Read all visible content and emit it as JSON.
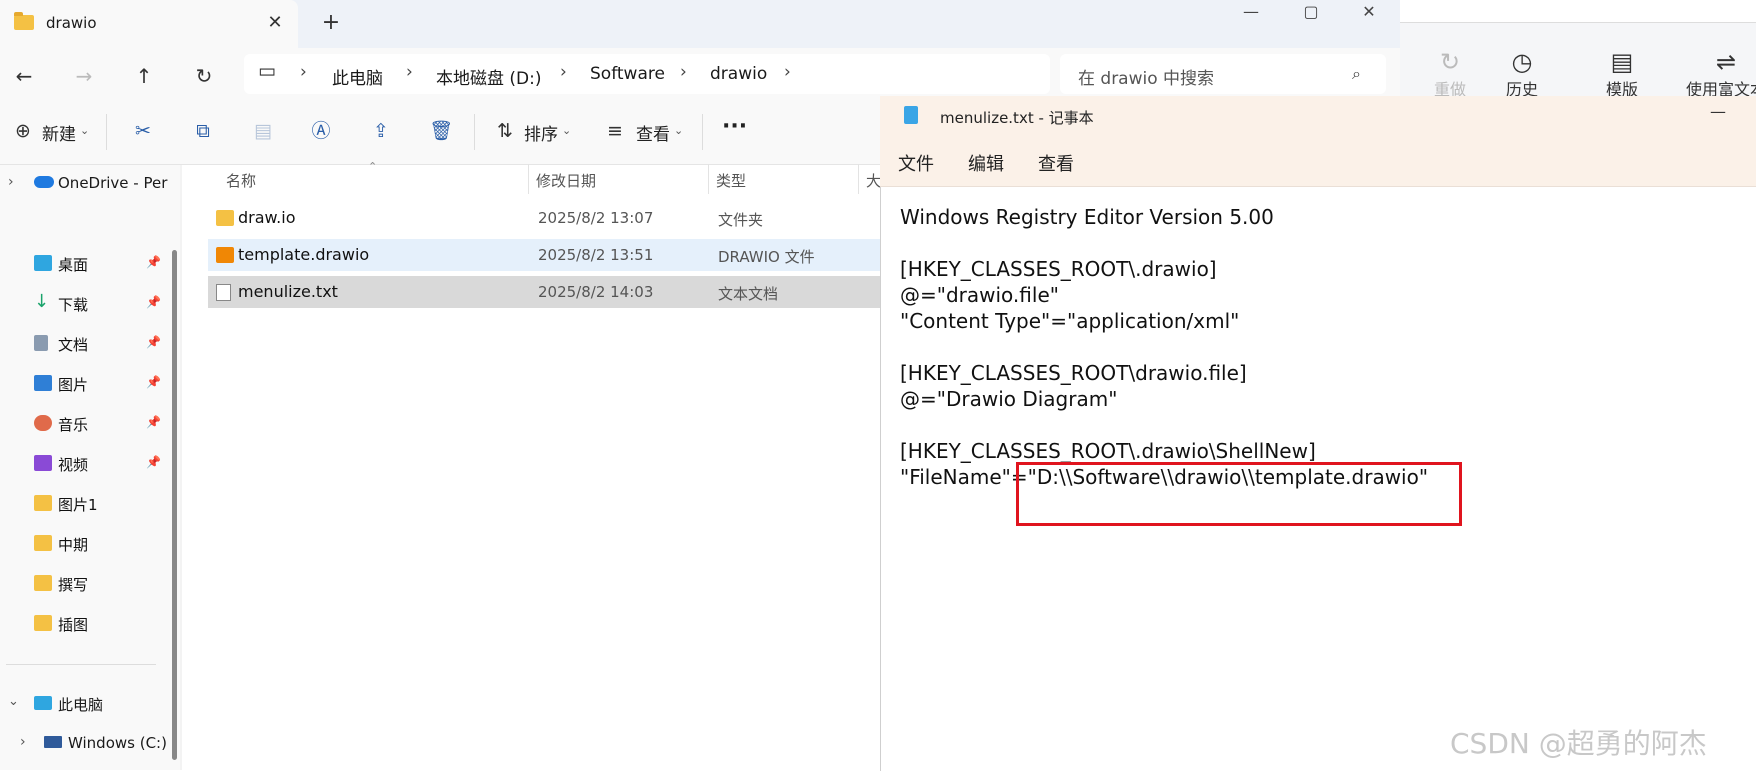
{
  "explorer": {
    "tab_title": "drawio",
    "tab_close": "✕",
    "new_tab": "+",
    "window_controls": {
      "minimize": "—",
      "maximize": "▢",
      "close": "✕"
    },
    "breadcrumb": [
      "此电脑",
      "本地磁盘 (D:)",
      "Software",
      "drawio"
    ],
    "search_placeholder": "在 drawio 中搜索",
    "toolbar": {
      "new_label": "新建",
      "sort_label": "排序",
      "view_label": "查看",
      "more_label": "···"
    },
    "nav": {
      "onedrive": "OneDrive - Per",
      "quick_access": [
        {
          "label": "桌面",
          "icon": "desktop-icon",
          "color": "#2fa6e0"
        },
        {
          "label": "下载",
          "icon": "download-icon",
          "color": "#1aa36b"
        },
        {
          "label": "文档",
          "icon": "document-icon",
          "color": "#8a9bb0"
        },
        {
          "label": "图片",
          "icon": "pictures-icon",
          "color": "#2f7fd6"
        },
        {
          "label": "音乐",
          "icon": "music-icon",
          "color": "#e06a4a"
        },
        {
          "label": "视频",
          "icon": "video-icon",
          "color": "#8a4ad6"
        }
      ],
      "folders": [
        "图片1",
        "中期",
        "撰写",
        "插图"
      ],
      "this_pc": "此电脑",
      "drive_c": "Windows (C:)"
    },
    "columns": {
      "name": "名称",
      "modified": "修改日期",
      "type": "类型",
      "size": "大"
    },
    "files": [
      {
        "name": "draw.io",
        "modified": "2025/8/2 13:07",
        "type": "文件夹",
        "icon": "folder-icon"
      },
      {
        "name": "template.drawio",
        "modified": "2025/8/2 13:51",
        "type": "DRAWIO 文件",
        "icon": "drawio-file-icon"
      },
      {
        "name": "menulize.txt",
        "modified": "2025/8/2 14:03",
        "type": "文本文档",
        "icon": "text-file-icon"
      }
    ]
  },
  "editor_toolbar": {
    "redo": "重做",
    "history": "历史",
    "template": "模版",
    "rich_text": "使用富文本"
  },
  "notepad": {
    "title": "menulize.txt - 记事本",
    "minimize": "—",
    "menu": [
      "文件",
      "编辑",
      "查看"
    ],
    "lines": [
      "Windows Registry Editor Version 5.00",
      "",
      "[HKEY_CLASSES_ROOT\\.drawio]",
      "@=\"drawio.file\"",
      "\"Content Type\"=\"application/xml\"",
      "",
      "[HKEY_CLASSES_ROOT\\drawio.file]",
      "@=\"Drawio Diagram\"",
      "",
      "[HKEY_CLASSES_ROOT\\.drawio\\ShellNew]",
      "\"FileName\"=\"D:\\\\Software\\\\drawio\\\\template.drawio\""
    ],
    "highlight_color": "#e0141e"
  },
  "watermark": "CSDN @超勇的阿杰"
}
